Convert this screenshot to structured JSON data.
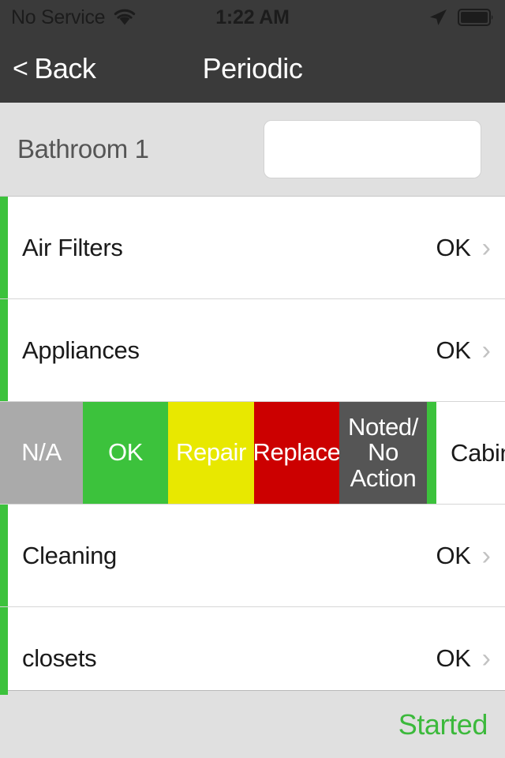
{
  "status_bar": {
    "carrier": "No Service",
    "time": "1:22 AM",
    "wifi_icon": "wifi-icon",
    "location_icon": "location-arrow-icon",
    "battery_icon": "battery-full-icon"
  },
  "nav_bar": {
    "back_chevron": "<",
    "back_label": "Back",
    "title": "Periodic"
  },
  "section": {
    "title": "Bathroom 1",
    "input_value": "",
    "input_placeholder": ""
  },
  "list": {
    "rows": [
      {
        "label": "Air Filters",
        "status": "OK",
        "chevron": "›",
        "flag_color": "#3cc23c"
      },
      {
        "label": "Appliances",
        "status": "OK",
        "chevron": "›",
        "flag_color": "#3cc23c"
      },
      {
        "label": "Cleaning",
        "status": "OK",
        "chevron": "›",
        "flag_color": "#3cc23c"
      },
      {
        "label": "closets",
        "status": "OK",
        "chevron": "›",
        "flag_color": "#3cc23c"
      }
    ],
    "swipe_row": {
      "underlying_label": "Cabinets",
      "flag_color": "#3cc23c",
      "actions": [
        {
          "label": "N/A",
          "color": "#aaaaaa"
        },
        {
          "label": "OK",
          "color": "#3cc23c"
        },
        {
          "label": "Repair",
          "color": "#e8e800"
        },
        {
          "label": "Replace",
          "color": "#cc0000"
        },
        {
          "label": "Noted/\nNo\nAction",
          "color": "#555555"
        }
      ]
    }
  },
  "footer": {
    "status_label": "Started",
    "status_color": "#3cb93c"
  }
}
